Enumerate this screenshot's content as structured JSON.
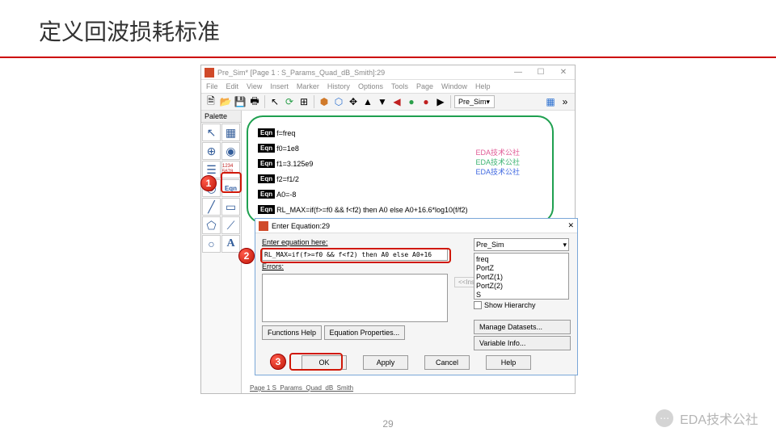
{
  "slide": {
    "title": "定义回波损耗标准",
    "page_number": "29"
  },
  "brand": {
    "label": "EDA技术公社",
    "icon": "⋯"
  },
  "app": {
    "title": "Pre_Sim* [Page 1 : S_Params_Quad_dB_Smith]:29",
    "menus": [
      "File",
      "Edit",
      "View",
      "Insert",
      "Marker",
      "History",
      "Options",
      "Tools",
      "Page",
      "Window",
      "Help"
    ],
    "toolbar_combo": "Pre_Sim",
    "palette_header": "Palette",
    "palette_eqn_label": "Eqn",
    "palette_num_label": "1234\n5678"
  },
  "equations": [
    {
      "tag": "Eqn",
      "expr": "f=freq"
    },
    {
      "tag": "Eqn",
      "expr": "f0=1e8"
    },
    {
      "tag": "Eqn",
      "expr": "f1=3.125e9"
    },
    {
      "tag": "Eqn",
      "expr": "f2=f1/2"
    },
    {
      "tag": "Eqn",
      "expr": "A0=-8"
    },
    {
      "tag": "Eqn",
      "expr": "RL_MAX=if(f>=f0 && f<f2) then A0 else A0+16.6*log10(f/f2)"
    }
  ],
  "watermark": {
    "line1": "EDA技术公社",
    "line2": "EDA技术公社",
    "line3": "EDA技术公社"
  },
  "dialog": {
    "title": "Enter Equation:29",
    "label_enter": "Enter equation here:",
    "input_value": "RL_MAX=if(f>=f0 && f<f2) then A0 else A0+16",
    "label_errors": "Errors:",
    "insert_btn": "<<Insert<<",
    "dataset_selected": "Pre_Sim",
    "dataset_items": [
      "freq",
      "PortZ",
      "PortZ(1)",
      "PortZ(2)",
      "S"
    ],
    "chk_hierarchy": "Show Hierarchy",
    "btn_functions": "Functions Help",
    "btn_eqprops": "Equation Properties...",
    "btn_manage": "Manage Datasets...",
    "btn_varinfo": "Variable Info...",
    "btn_ok": "OK",
    "btn_apply": "Apply",
    "btn_cancel": "Cancel",
    "btn_help": "Help"
  },
  "callouts": {
    "c1": "1",
    "c2": "2",
    "c3": "3"
  },
  "page_tab": "Page 1   S_Params_Quad_dB_Smith"
}
